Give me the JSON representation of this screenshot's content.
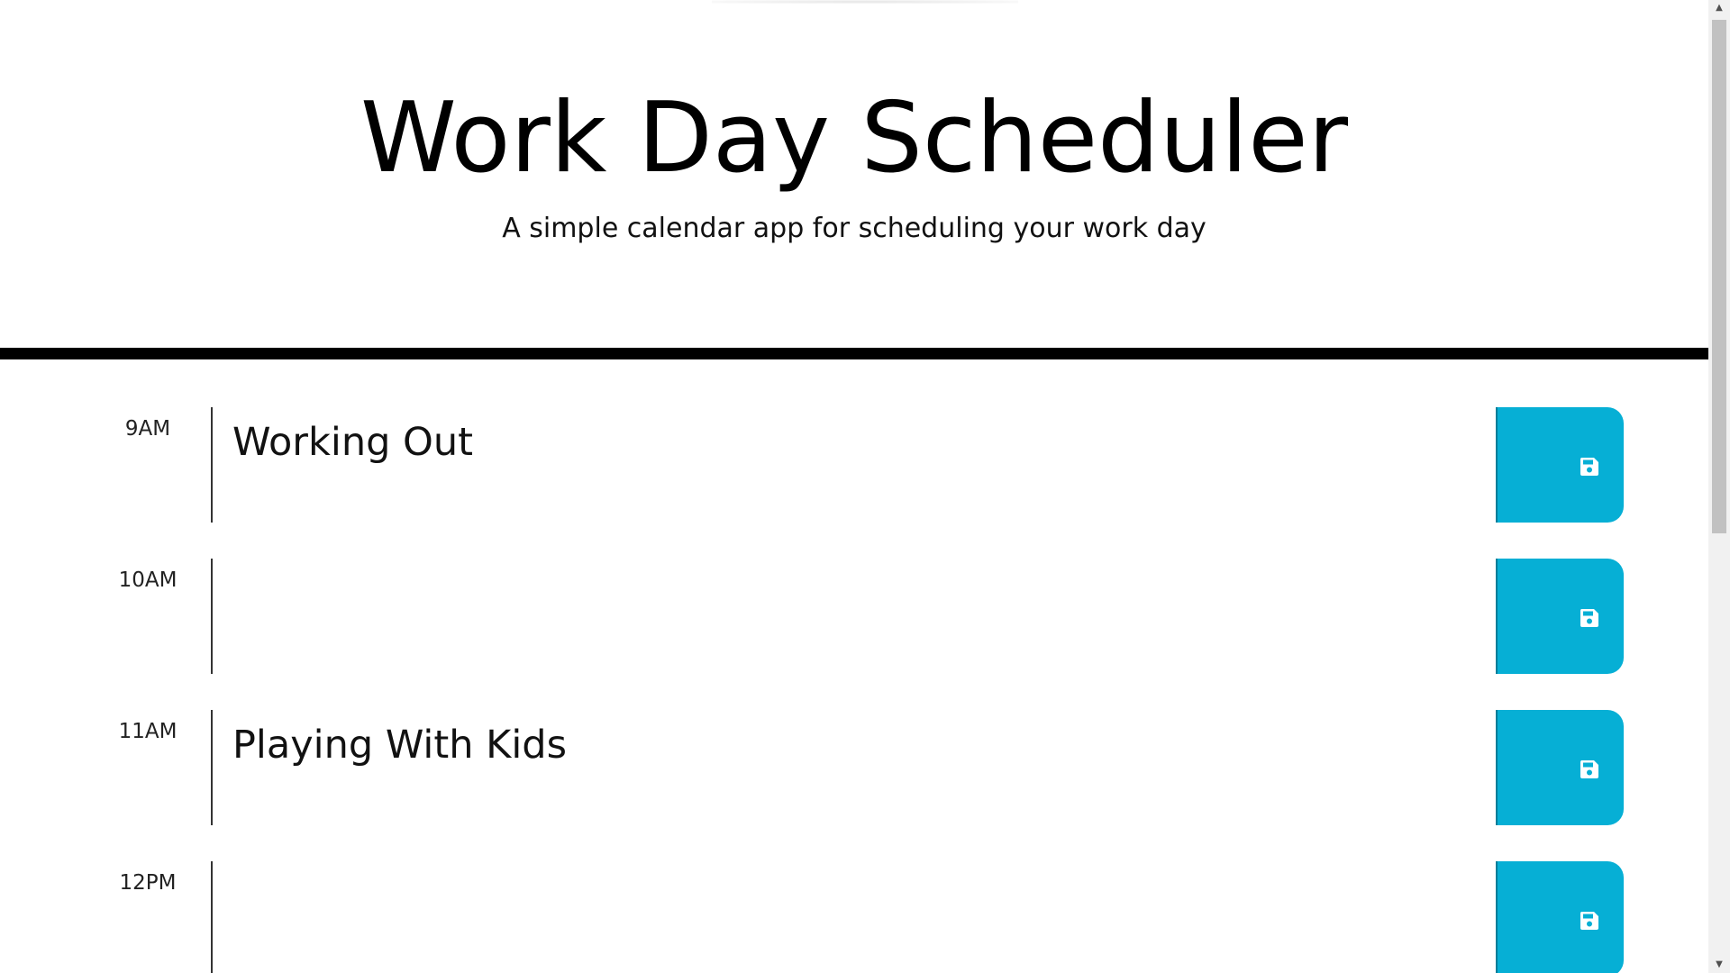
{
  "header": {
    "title": "Work Day Scheduler",
    "subtitle": "A simple calendar app for scheduling your work day"
  },
  "colors": {
    "save_button": "#06afd5",
    "divider": "#000000"
  },
  "rows": [
    {
      "hour": "9AM",
      "event": "Working Out",
      "save_icon": "save-icon"
    },
    {
      "hour": "10AM",
      "event": "",
      "save_icon": "save-icon"
    },
    {
      "hour": "11AM",
      "event": "Playing With Kids",
      "save_icon": "save-icon"
    },
    {
      "hour": "12PM",
      "event": "",
      "save_icon": "save-icon"
    }
  ],
  "scrollbar": {
    "up_arrow": "▲",
    "down_arrow": "▼"
  }
}
